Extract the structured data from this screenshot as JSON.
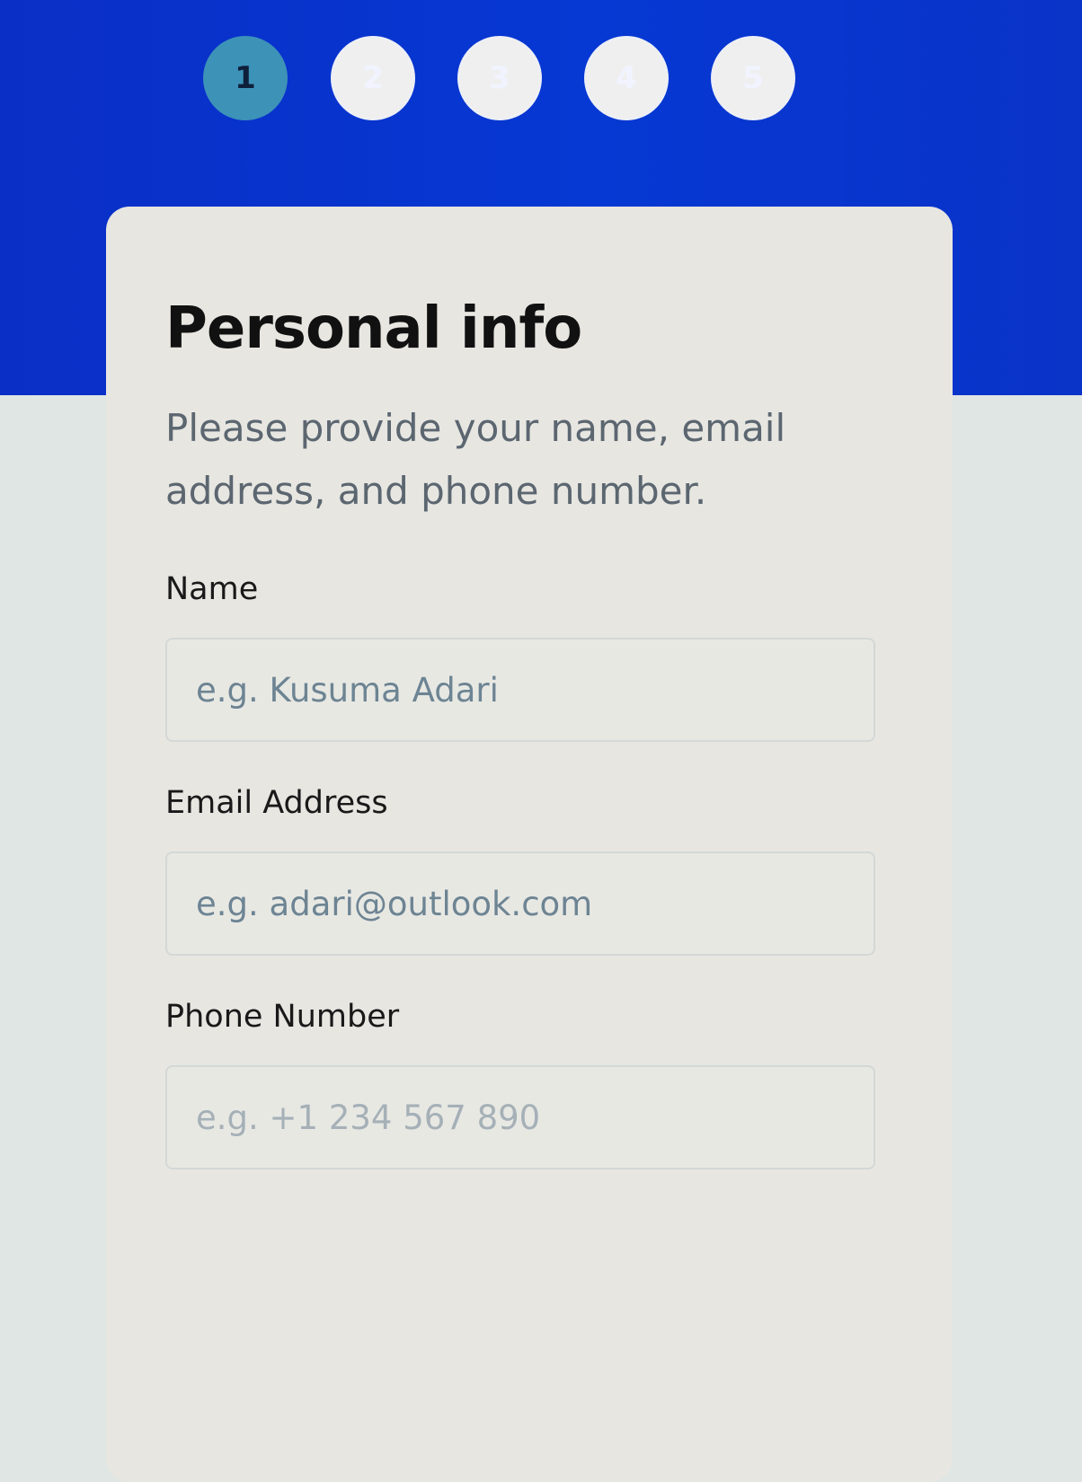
{
  "steps": [
    {
      "number": "1",
      "state": "active"
    },
    {
      "number": "2",
      "state": "inactive"
    },
    {
      "number": "3",
      "state": "inactive"
    },
    {
      "number": "4",
      "state": "inactive"
    },
    {
      "number": "5",
      "state": "inactive"
    }
  ],
  "form": {
    "title": "Personal info",
    "description": "Please provide your name, email address, and phone number.",
    "fields": {
      "name": {
        "label": "Name",
        "placeholder": "e.g. Kusuma Adari"
      },
      "email": {
        "label": "Email Address",
        "placeholder": "e.g. adari@outlook.com"
      },
      "phone": {
        "label": "Phone Number",
        "placeholder": "e.g. +1 234 567 890"
      }
    }
  },
  "colors": {
    "header_background": "#0638d3",
    "active_step": "#3d92b8",
    "card_background": "#e7e6e1",
    "page_background": "#dfe6e3"
  }
}
